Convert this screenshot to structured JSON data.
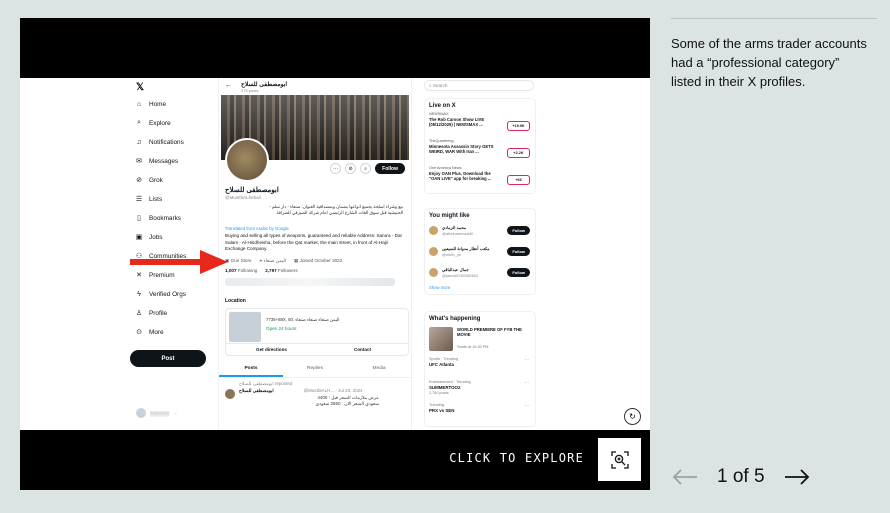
{
  "gallery": {
    "explore_label": "CLICK TO EXPLORE",
    "caption": "Some of the arms trader accounts had a “professional category” listed in their X profiles.",
    "current": "1 of 5"
  },
  "x": {
    "nav": [
      "Home",
      "Explore",
      "Notifications",
      "Messages",
      "Grok",
      "Lists",
      "Bookmarks",
      "Jobs",
      "Communities",
      "Premium",
      "Verified Orgs",
      "Profile",
      "More"
    ],
    "post_button": "Post",
    "header_name": "ابومصطفى للسلاح",
    "header_sub": "275 posts",
    "profile_name": "ابومصطفى للسلاح",
    "profile_handle": "@MustfaALhebari",
    "follow_label": "Follow",
    "bio_ar": "بيع وشراء اسلحة بجميع انواعها بضمان وبمصداقية العنوان: صنعاء - دار سلم - الحنيشية قبل سوق القات الشارع الرئيسي امام شركة الصيرفي للصرافة",
    "translated_label": "Translated from Arabic by Google",
    "bio_en": "Buying and selling all types of weapons, guaranteed and reliable Address: Sana'a - Dar Salam - Al-Hindheisha, before the Qat market, the main street, in front of Al-Hajri Exchange Company.",
    "category": "Gun Store",
    "location_meta": "اليمن صنعاء",
    "joined": "Joined October 2022",
    "following_count": "1,007",
    "following_label": "Following",
    "followers_count": "2,797",
    "followers_label": "Followers",
    "location_title": "Location",
    "location_address": "7735+88X, 50, اليمن صنعاء صنعاء صنعاء",
    "location_hours": "Open 24 hours",
    "get_directions": "Get directions",
    "contact": "Contact",
    "tabs": [
      "Posts",
      "Replies",
      "Media"
    ],
    "post_repost": "ابومصطفى للسلاح reposted",
    "post_author": "ابومصطفى للسلاح",
    "post_meta": "@MustfaALH... · Jul 23, 2024",
    "post_body": "عرض ملازمات  السعر قبل : 4400 سعودي السعر الان : 2650 سعودي",
    "search_placeholder": "Search",
    "live_title": "Live on X",
    "live": [
      {
        "src": "NEWSMAX",
        "title": "The Rob Carson Show LIVE (05/12/2025) | NEWSMAX ...",
        "badge": "+19.9K"
      },
      {
        "src": "TheQuartering",
        "title": "Minnesota Assassin Story GETS WEIRD, WAR With Iran ...",
        "badge": "+2.2K"
      },
      {
        "src": "One America News",
        "title": "Enjoy OAN Plus. Download the \"OAN LIVE\" app for breaking ...",
        "badge": "+66"
      }
    ],
    "wtf_title": "You might like",
    "wtf": [
      {
        "name": "محمد الزمادي",
        "handle": "@alimhammad40"
      },
      {
        "name": "مكتب أنظار مدوانة للسيعين",
        "handle": "@mkth_yn"
      },
      {
        "name": "جمال عبدالباقي",
        "handle": "@jamal4745550480"
      }
    ],
    "show_more": "Show more",
    "happening_title": "What's happening",
    "featured": {
      "title": "WORLD PREMIERE OF FYB THE MOVIE",
      "time": "Starts at 10:30 PM"
    },
    "trends": [
      {
        "cat": "Sports · Trending",
        "title": "UFC Atlanta",
        "count": ""
      },
      {
        "cat": "Entertainment · Trending",
        "title": "SUMMERTOO2",
        "count": "2,750 posts"
      },
      {
        "cat": "Trending",
        "title": "PRX vs SEN",
        "count": ""
      }
    ]
  },
  "colors": {
    "arrow": "#e8281b",
    "accent": "#1d9bf0",
    "bg": "#dce3e3"
  }
}
